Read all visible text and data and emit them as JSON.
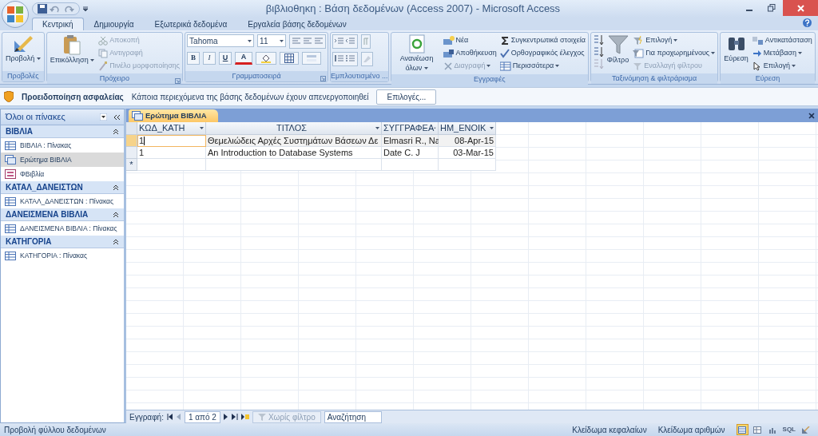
{
  "window": {
    "title": "βιβλιοθηκη : Βάση δεδομένων (Access 2007) - Microsoft Access"
  },
  "tabs": [
    {
      "label": "Κεντρική",
      "selected": true
    },
    {
      "label": "Δημιουργία",
      "selected": false
    },
    {
      "label": "Εξωτερικά δεδομένα",
      "selected": false
    },
    {
      "label": "Εργαλεία βάσης δεδομένων",
      "selected": false
    }
  ],
  "ribbon": {
    "groups": [
      {
        "kind": "standard",
        "label": "Προβολές",
        "launcher": false,
        "large": [
          {
            "label": "Προβολή",
            "dropdown": true,
            "disabled": false
          }
        ]
      },
      {
        "kind": "standard",
        "label": "Πρόχειρο",
        "launcher": true,
        "large": [
          {
            "label": "Επικόλληση",
            "dropdown": true,
            "disabled": false
          }
        ],
        "columns": [
          [
            {
              "label": "Αποκοπή",
              "dropdown": false,
              "disabled": true
            },
            {
              "label": "Αντιγραφή",
              "dropdown": false,
              "disabled": true
            },
            {
              "label": "Πινέλο μορφοποίησης",
              "dropdown": false,
              "disabled": true
            }
          ]
        ]
      },
      {
        "kind": "font",
        "label": "Γραμματοσειρά",
        "launcher": true,
        "font_name": "Tahoma",
        "font_size": "11",
        "format_buttons": [
          {
            "label": "B",
            "kind": "bold"
          },
          {
            "label": "I",
            "kind": "italic"
          },
          {
            "label": "U",
            "kind": "underline"
          },
          {
            "label": "A",
            "kind": "color"
          }
        ]
      },
      {
        "kind": "icons",
        "label": "Εμπλουτισμένο ...",
        "launcher": false
      },
      {
        "kind": "standard",
        "label": "Εγγραφές",
        "launcher": false,
        "large": [
          {
            "label": "Ανανέωση όλων",
            "dropdown": true,
            "disabled": false
          }
        ],
        "columns": [
          [
            {
              "label": "Νέα",
              "dropdown": false,
              "disabled": false
            },
            {
              "label": "Αποθήκευση",
              "dropdown": false,
              "disabled": false
            },
            {
              "label": "Διαγραφή",
              "dropdown": true,
              "disabled": true
            }
          ],
          [
            {
              "label": "Συγκεντρωτικά στοιχεία",
              "dropdown": false,
              "disabled": false
            },
            {
              "label": "Ορθογραφικός έλεγχος",
              "dropdown": false,
              "disabled": false
            },
            {
              "label": "Περισσότερα",
              "dropdown": true,
              "disabled": false
            }
          ]
        ]
      },
      {
        "kind": "sort",
        "label": "Ταξινόμηση & φιλτράρισμα",
        "launcher": false,
        "large": [
          {
            "label": "Φίλτρο",
            "dropdown": false,
            "disabled": false
          }
        ],
        "columns": [
          [
            {
              "label": "Επιλογή",
              "dropdown": true,
              "disabled": false
            },
            {
              "label": "Για προχωρημένους",
              "dropdown": true,
              "disabled": false
            },
            {
              "label": "Εναλλαγή φίλτρου",
              "dropdown": false,
              "disabled": true
            }
          ]
        ]
      },
      {
        "kind": "standard",
        "label": "Εύρεση",
        "launcher": false,
        "large": [
          {
            "label": "Εύρεση",
            "dropdown": false,
            "disabled": false
          }
        ],
        "columns": [
          [
            {
              "label": "Αντικατάσταση",
              "dropdown": false,
              "disabled": false
            },
            {
              "label": "Μετάβαση",
              "dropdown": true,
              "disabled": false
            },
            {
              "label": "Επιλογή",
              "dropdown": true,
              "disabled": false
            }
          ]
        ]
      }
    ]
  },
  "security_bar": {
    "title": "Προειδοποίηση ασφαλείας",
    "message": "Κάποια περιεχόμενα της βάσης δεδομένων έχουν απενεργοποιηθεί",
    "button": "Επιλογές..."
  },
  "nav_pane": {
    "header": "Όλοι οι πίνακες",
    "groups": [
      {
        "label": "ΒΙΒΛΙΑ",
        "expanded": true,
        "items": [
          {
            "label": "ΒΙΒΛΙΑ : Πίνακας",
            "kind": "table",
            "selected": false
          },
          {
            "label": "Ερώτημα ΒΙΒΛΙΑ",
            "kind": "query",
            "selected": true
          },
          {
            "label": "ΦΒιβλία",
            "kind": "form",
            "selected": false
          }
        ]
      },
      {
        "label": "ΚΑΤΑΛ_ΔΑΝΕΙΣΤΩΝ",
        "expanded": true,
        "items": [
          {
            "label": "ΚΑΤΑΛ_ΔΑΝΕΙΣΤΩΝ : Πίνακας",
            "kind": "table",
            "selected": false
          }
        ]
      },
      {
        "label": "ΔΑΝΕΙΣΜΕΝΑ ΒΙΒΛΙΑ",
        "expanded": true,
        "items": [
          {
            "label": "ΔΑΝΕΙΣΜΕΝΑ ΒΙΒΛΙΑ : Πίνακας",
            "kind": "table",
            "selected": false
          }
        ]
      },
      {
        "label": "ΚΑΤΗΓΟΡΙΑ",
        "expanded": true,
        "items": [
          {
            "label": "ΚΑΤΗΓΟΡΙΑ : Πίνακας",
            "kind": "table",
            "selected": false
          }
        ]
      }
    ]
  },
  "document_tabs": [
    {
      "label": "Ερώτημα ΒΙΒΛΙΑ",
      "selected": true
    }
  ],
  "datasheet": {
    "columns": [
      {
        "label": "ΚΩΔ_ΚΑΤΗ"
      },
      {
        "label": "ΤΙΤΛΟΣ"
      },
      {
        "label": "ΣΥΓΓΡΑΦΕΑ"
      },
      {
        "label": "ΗΜ_ΕΝΟΙΚ"
      }
    ],
    "rows": [
      {
        "current": true,
        "cells": [
          "1",
          "Θεμελιώδεις Αρχές Συστημάτων Βάσεων Δε",
          "Elmasri R., Na",
          "08-Apr-15"
        ]
      },
      {
        "current": false,
        "cells": [
          "1",
          "An Introduction to Database Systems",
          "Date C. J",
          "03-Mar-15"
        ]
      }
    ],
    "new_row_marker": "*"
  },
  "record_nav": {
    "label": "Εγγραφή:",
    "position": "1 από 2",
    "filter": {
      "label": "Χωρίς φίλτρο",
      "disabled": true
    },
    "search": {
      "placeholder": "Αναζήτηση"
    }
  },
  "status_bar": {
    "text": "Προβολή φύλλου δεδομένων",
    "indicators": [
      "Κλείδωμα κεφαλαίων",
      "Κλείδωμα αριθμών"
    ],
    "view_buttons": [
      {
        "selected": true
      },
      {
        "selected": false
      },
      {
        "selected": false
      },
      {
        "label": "SQL",
        "selected": false
      },
      {
        "selected": false
      }
    ]
  }
}
